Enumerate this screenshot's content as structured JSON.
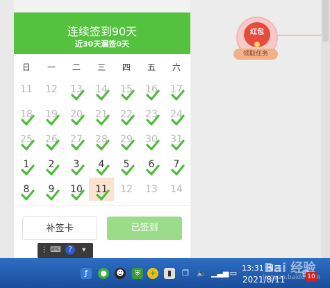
{
  "header": {
    "title": "连续签到90天",
    "subtitle": "近30天漏签0天"
  },
  "weekdays": [
    "日",
    "一",
    "二",
    "三",
    "四",
    "五",
    "六"
  ],
  "calendar": {
    "days": [
      {
        "label": "11",
        "state": "prev",
        "checked": false
      },
      {
        "label": "12",
        "state": "prev",
        "checked": false
      },
      {
        "label": "13",
        "state": "prev",
        "checked": true
      },
      {
        "label": "14",
        "state": "prev",
        "checked": true
      },
      {
        "label": "15",
        "state": "prev",
        "checked": true
      },
      {
        "label": "16",
        "state": "prev",
        "checked": true
      },
      {
        "label": "17",
        "state": "prev",
        "checked": true
      },
      {
        "label": "18",
        "state": "prev",
        "checked": true
      },
      {
        "label": "19",
        "state": "prev",
        "checked": true
      },
      {
        "label": "20",
        "state": "prev",
        "checked": true
      },
      {
        "label": "21",
        "state": "prev",
        "checked": true
      },
      {
        "label": "22",
        "state": "prev",
        "checked": true
      },
      {
        "label": "23",
        "state": "prev",
        "checked": true
      },
      {
        "label": "24",
        "state": "prev",
        "checked": true
      },
      {
        "label": "25",
        "state": "prev",
        "checked": true
      },
      {
        "label": "26",
        "state": "prev",
        "checked": true
      },
      {
        "label": "27",
        "state": "prev",
        "checked": true
      },
      {
        "label": "28",
        "state": "prev",
        "checked": true
      },
      {
        "label": "29",
        "state": "prev",
        "checked": true
      },
      {
        "label": "30",
        "state": "prev",
        "checked": true
      },
      {
        "label": "31",
        "state": "prev",
        "checked": true
      },
      {
        "label": "1",
        "state": "cur",
        "checked": true
      },
      {
        "label": "2",
        "state": "cur",
        "checked": true
      },
      {
        "label": "3",
        "state": "cur",
        "checked": true
      },
      {
        "label": "4",
        "state": "cur",
        "checked": true
      },
      {
        "label": "5",
        "state": "cur",
        "checked": true
      },
      {
        "label": "6",
        "state": "cur",
        "checked": true
      },
      {
        "label": "7",
        "state": "cur",
        "checked": true
      },
      {
        "label": "8",
        "state": "cur",
        "checked": true
      },
      {
        "label": "9",
        "state": "cur",
        "checked": true
      },
      {
        "label": "10",
        "state": "cur",
        "checked": true
      },
      {
        "label": "11",
        "state": "today",
        "checked": true
      },
      {
        "label": "12",
        "state": "future",
        "checked": false
      },
      {
        "label": "13",
        "state": "future",
        "checked": false
      },
      {
        "label": "14",
        "state": "future",
        "checked": false
      }
    ]
  },
  "buttons": {
    "makeup": "补签卡",
    "signed": "已签到"
  },
  "red_packet": {
    "title": "红包",
    "task_label": "领取任务"
  },
  "taskbar": {
    "time": "13:31 周三",
    "date": "2021/8/11",
    "notification_count": "10",
    "watermark_brand": "Bai 经验",
    "watermark_url": "jingyan.baidu.com"
  },
  "colors": {
    "header_green": "#54c23f",
    "check_green": "#4cbc3a",
    "signed_button": "#9bdc8a",
    "today_bg": "#fde3cf",
    "red_packet": "#e54b3e"
  },
  "icons": {
    "check": "check-icon",
    "ime": [
      "grip-icon",
      "keyboard-icon",
      "help-icon",
      "dropdown-icon"
    ],
    "tray": [
      "flash-icon",
      "wechat-icon",
      "qq-icon",
      "shield-icon",
      "security-plus-icon",
      "device-icon",
      "copy-icon",
      "speaker-icon",
      "signal-icon",
      "battery-icon",
      "notification-icon"
    ]
  }
}
